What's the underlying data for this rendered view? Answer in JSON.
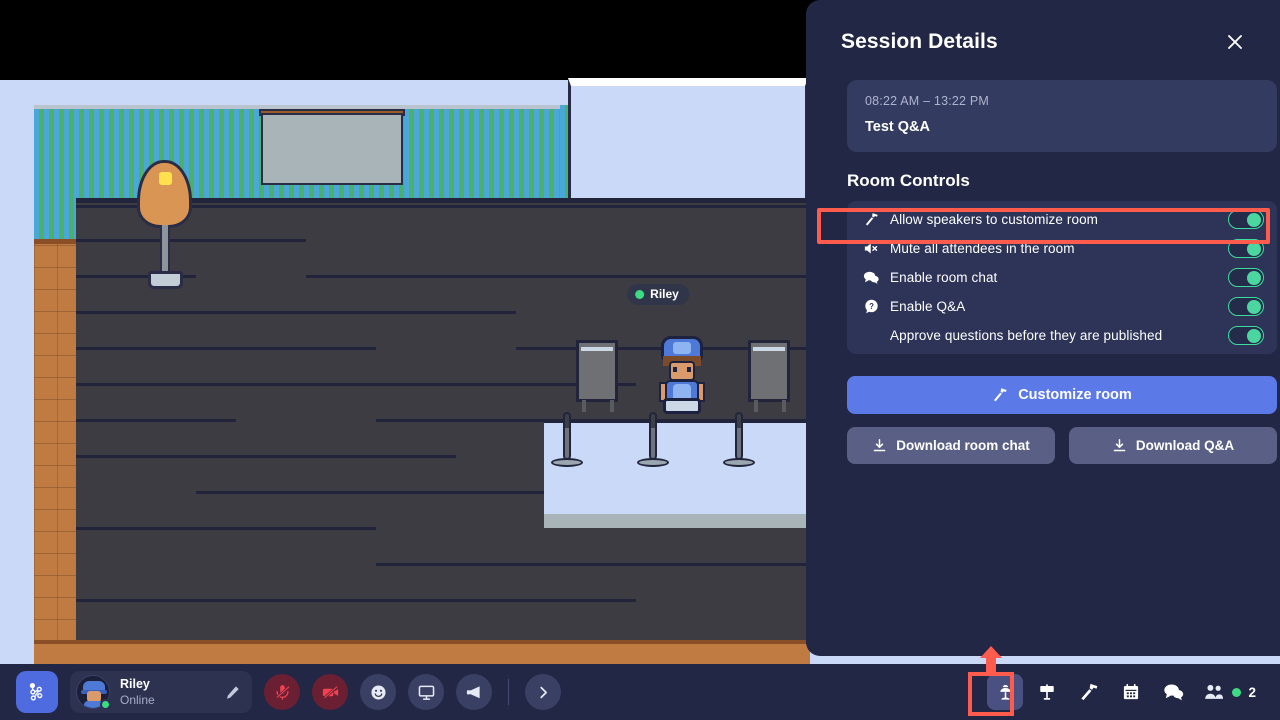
{
  "panel": {
    "title": "Session Details",
    "close_icon": "close-icon",
    "session": {
      "time_range": "08:22 AM – 13:22 PM",
      "name": "Test Q&A"
    },
    "section_title": "Room Controls",
    "controls": [
      {
        "icon": "hammer-icon",
        "label": "Allow speakers to customize room",
        "toggle": "on",
        "indent": false
      },
      {
        "icon": "speaker-mute-icon",
        "label": "Mute all attendees in the room",
        "toggle": "on",
        "indent": false
      },
      {
        "icon": "chat-icon",
        "label": "Enable room chat",
        "toggle": "on",
        "indent": false
      },
      {
        "icon": "question-icon",
        "label": "Enable Q&A",
        "toggle": "on",
        "indent": false
      },
      {
        "icon": "none",
        "label": "Approve questions before they are published",
        "toggle": "on",
        "indent": true
      }
    ],
    "primary_button": {
      "label": "Customize room",
      "icon": "hammer-icon"
    },
    "secondary_buttons": [
      {
        "label": "Download room chat",
        "icon": "download-icon"
      },
      {
        "label": "Download Q&A",
        "icon": "download-icon"
      }
    ]
  },
  "scene": {
    "nameplate": "Riley",
    "nameplate_status_color": "#3ddc84"
  },
  "bottombar": {
    "map_button_icon": "map-connections-icon",
    "user": {
      "name": "Riley",
      "status": "Online",
      "edit_icon": "pencil-icon",
      "avatar": "avatar"
    },
    "media_buttons": [
      {
        "icon": "mic-off-icon",
        "state": "muted"
      },
      {
        "icon": "camera-off-icon",
        "state": "off"
      },
      {
        "icon": "emoji-icon",
        "state": "normal"
      },
      {
        "icon": "screen-share-icon",
        "state": "normal"
      },
      {
        "icon": "megaphone-icon",
        "state": "normal"
      }
    ],
    "expand_icon": "chevron-right-icon",
    "tools": [
      {
        "icon": "session-lamp-icon",
        "active": true,
        "name": "tool-session"
      },
      {
        "icon": "sign-icon",
        "active": false,
        "name": "tool-sign"
      },
      {
        "icon": "hammer-icon",
        "active": false,
        "name": "tool-build"
      },
      {
        "icon": "calendar-icon",
        "active": false,
        "name": "tool-calendar"
      },
      {
        "icon": "chat-icon",
        "active": false,
        "name": "tool-chat"
      }
    ],
    "people": {
      "icon": "people-icon",
      "count": "2",
      "dot_color": "#3ddc84"
    }
  },
  "highlights": {
    "row_color": "#ff5c4d",
    "tool_color": "#ff5c4d"
  }
}
